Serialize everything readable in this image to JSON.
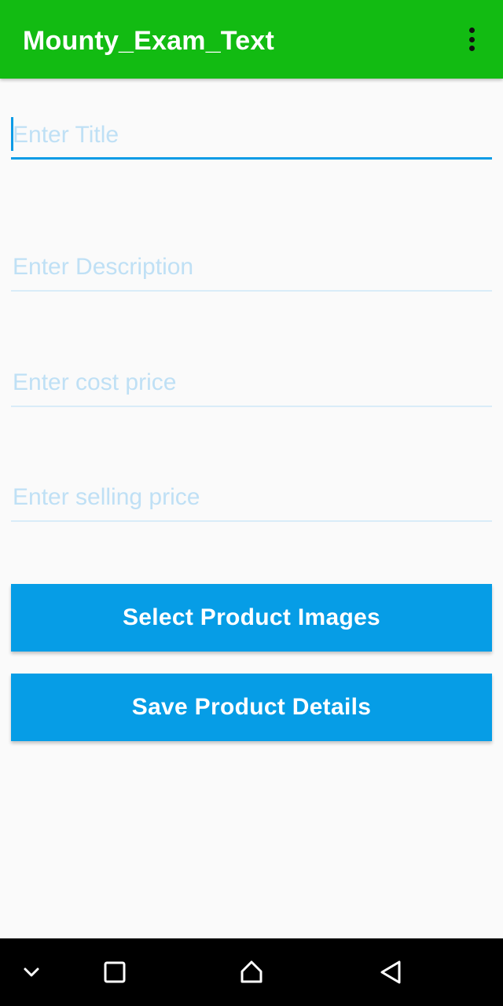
{
  "app_bar": {
    "title": "Mounty_Exam_Text",
    "menu_icon": "more-vert-icon",
    "background_color": "#12bb12"
  },
  "form": {
    "title_placeholder": "Enter Title",
    "description_placeholder": "Enter Description",
    "cost_price_placeholder": "Enter cost price",
    "selling_price_placeholder": "Enter selling price",
    "focused_field": "title"
  },
  "buttons": {
    "select_images_label": "Select Product Images",
    "save_details_label": "Save Product Details",
    "color": "#069de6"
  },
  "nav_bar": {
    "icons": [
      "chevron-down-icon",
      "recents-square-icon",
      "home-icon",
      "back-triangle-icon"
    ]
  }
}
